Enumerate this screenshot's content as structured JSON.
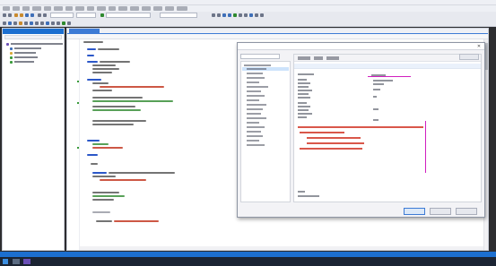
{
  "window": {
    "title": ""
  },
  "solution_explorer": {
    "title": "",
    "items": [
      {
        "label": "",
        "icon": "solution-icon"
      },
      {
        "label": "",
        "icon": "project-icon"
      },
      {
        "label": "",
        "icon": "folder-icon"
      },
      {
        "label": "",
        "icon": "file-icon"
      },
      {
        "label": "",
        "icon": "file-icon"
      }
    ]
  },
  "editor": {
    "active_tab": "",
    "navigation": "",
    "header_text": ""
  },
  "dialog": {
    "title": "",
    "search_placeholder": "",
    "tree_items": [],
    "ok_label": "",
    "cancel_label": "",
    "apply_label": ""
  },
  "colors": {
    "accent": "#1c6fd0",
    "keyword": "#2b57c8",
    "string": "#c43b25",
    "comment": "#2e8a2e",
    "highlight": "#d11fbf"
  }
}
